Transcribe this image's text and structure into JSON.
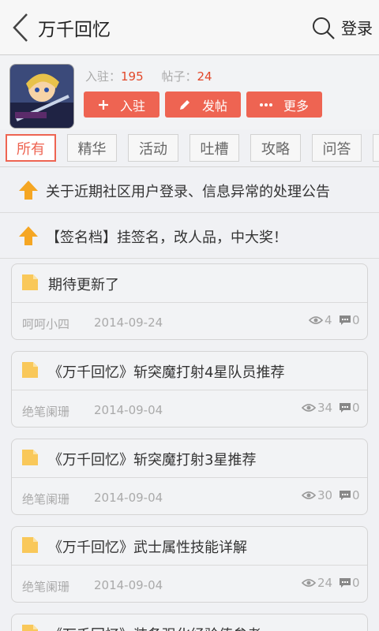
{
  "header": {
    "title": "万千回忆",
    "login_label": "登录"
  },
  "forum": {
    "stats": {
      "members_label": "入驻：",
      "members_value": "195",
      "posts_label": "帖子：",
      "posts_value": "24"
    },
    "actions": {
      "join_label": "入驻",
      "post_label": "发帖",
      "more_label": "更多"
    }
  },
  "tabs": [
    "所有",
    "精华",
    "活动",
    "吐槽",
    "攻略",
    "问答"
  ],
  "notices": [
    "关于近期社区用户登录、信息异常的处理公告",
    "【签名档】挂签名，改人品，中大奖！"
  ],
  "posts": [
    {
      "title": "期待更新了",
      "author": "呵呵小四",
      "date": "2014-09-24",
      "views": "4",
      "comments": "0"
    },
    {
      "title": "《万千回忆》斩突魔打射4星队员推荐",
      "author": "绝笔阑珊",
      "date": "2014-09-04",
      "views": "34",
      "comments": "0"
    },
    {
      "title": "《万千回忆》斩突魔打射3星推荐",
      "author": "绝笔阑珊",
      "date": "2014-09-04",
      "views": "30",
      "comments": "0"
    },
    {
      "title": "《万千回忆》武士属性技能详解",
      "author": "绝笔阑珊",
      "date": "2014-09-04",
      "views": "24",
      "comments": "0"
    },
    {
      "title": "《万千回忆》装备强化经验值参考",
      "author": "",
      "date": "",
      "views": "",
      "comments": ""
    }
  ],
  "colors": {
    "accent": "#ee6452",
    "notice_arrow": "#f5a623",
    "doc_icon": "#f9c85a",
    "stat_value": "#e2482a"
  }
}
